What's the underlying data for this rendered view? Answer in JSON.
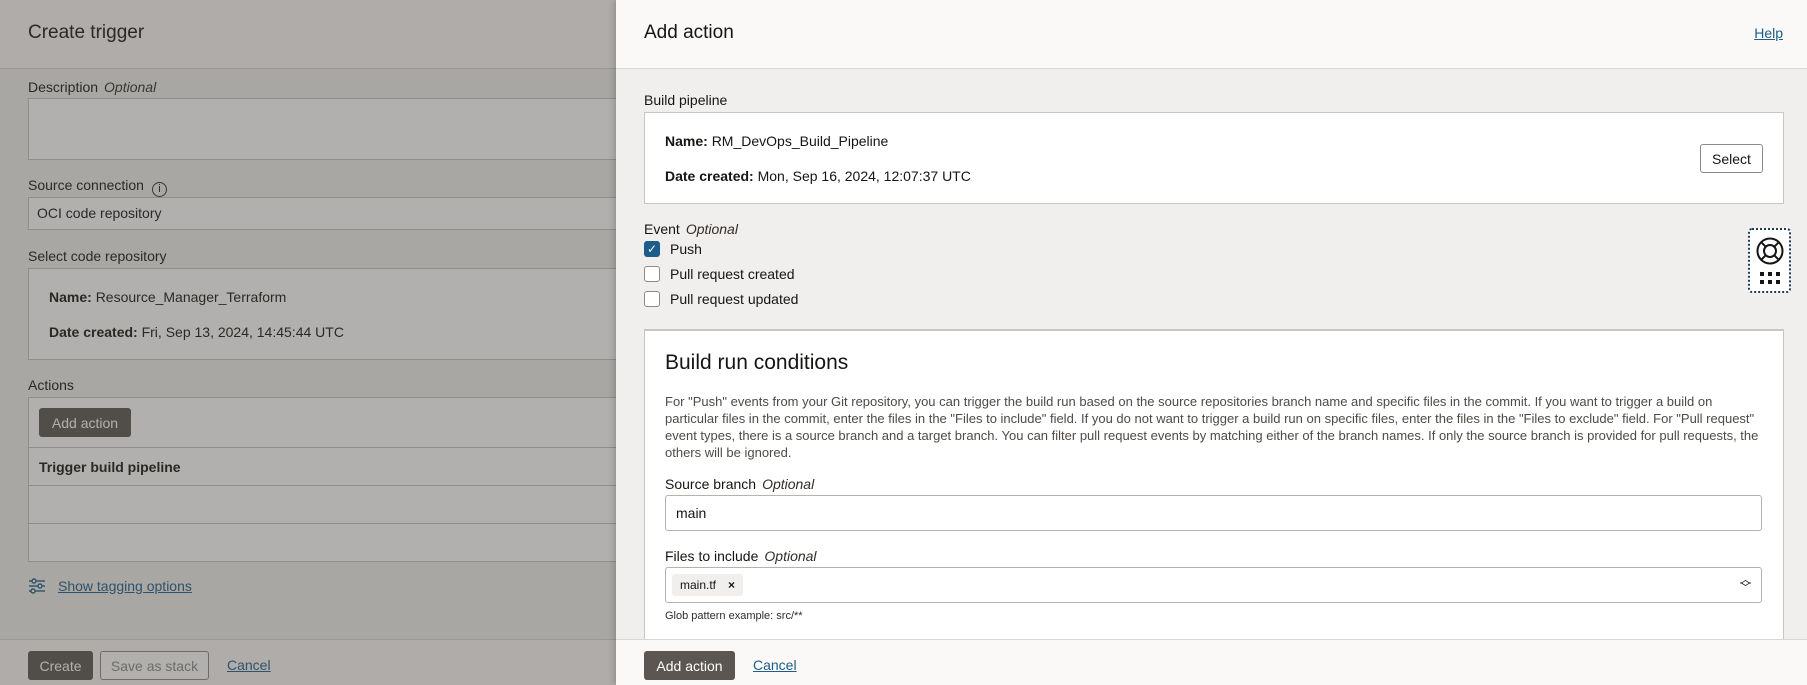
{
  "background": {
    "title": "Create trigger",
    "description": {
      "label": "Description",
      "optional": "Optional",
      "value": ""
    },
    "source_connection": {
      "label": "Source connection",
      "info_icon": "info-icon",
      "value": "OCI code repository"
    },
    "select_repo": {
      "label": "Select code repository",
      "name_key": "Name:",
      "name_value": "Resource_Manager_Terraform",
      "date_key": "Date created:",
      "date_value": "Fri, Sep 13, 2024, 14:45:44 UTC"
    },
    "actions": {
      "label": "Actions",
      "add_action": "Add action",
      "column_header": "Trigger build pipeline"
    },
    "tagging_link": "Show tagging options",
    "tagging_icon": "sliders-icon",
    "footer": {
      "create": "Create",
      "save_as_stack": "Save as stack",
      "cancel": "Cancel"
    }
  },
  "panel": {
    "title": "Add action",
    "help": "Help",
    "build_pipeline": {
      "label": "Build pipeline",
      "name_key": "Name:",
      "name_value": "RM_DevOps_Build_Pipeline",
      "date_key": "Date created:",
      "date_value": "Mon, Sep 16, 2024, 12:07:37 UTC",
      "select_button": "Select"
    },
    "event": {
      "label": "Event",
      "optional": "Optional",
      "options": [
        {
          "label": "Push",
          "checked": true
        },
        {
          "label": "Pull request created",
          "checked": false
        },
        {
          "label": "Pull request updated",
          "checked": false
        }
      ]
    },
    "conditions": {
      "title": "Build run conditions",
      "description": "For \"Push\" events from your Git repository, you can trigger the build run based on the source repositories branch name and specific files in the commit. If you want to trigger a build on particular files in the commit, enter the files in the \"Files to include\" field. If you do not want to trigger a build run on specific files, enter the files in the \"Files to exclude\" field. For \"Pull request\" event types, there is a source branch and a target branch. You can filter pull request events by matching either of the branch names. If only the source branch is provided for pull requests, the others will be ignored.",
      "source_branch": {
        "label": "Source branch",
        "optional": "Optional",
        "value": "main"
      },
      "files_include": {
        "label": "Files to include",
        "optional": "Optional",
        "chip": "main.tf",
        "chip_remove": "×",
        "hint": "Glob pattern example: src/**"
      }
    },
    "footer": {
      "add_action": "Add action",
      "cancel": "Cancel"
    }
  },
  "help_widget": {
    "icons": [
      "lifebuoy-icon",
      "grid-dots-icon"
    ]
  },
  "colors": {
    "link": "#1c5d8a",
    "primary_button": "#5b5652",
    "checkbox": "#1c5d8a"
  }
}
